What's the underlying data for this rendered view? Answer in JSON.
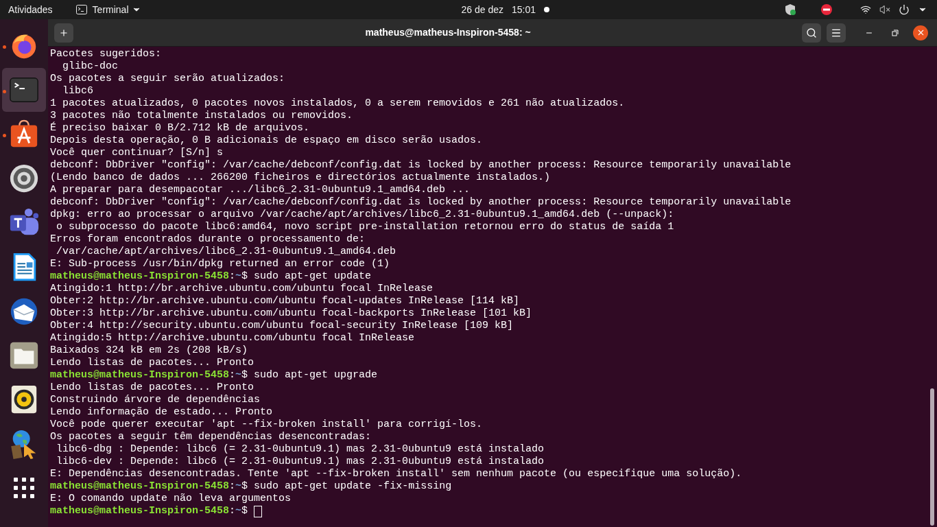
{
  "top_bar": {
    "activities": "Atividades",
    "app_menu": "Terminal",
    "date": "26 de dez",
    "time": "15:01",
    "notification_dot": true
  },
  "dock": {
    "items": [
      {
        "kind": "browser",
        "running": true,
        "selected": false
      },
      {
        "kind": "terminal",
        "running": true,
        "selected": true
      },
      {
        "kind": "store",
        "running": true,
        "selected": false
      },
      {
        "kind": "settings",
        "running": false,
        "selected": false
      },
      {
        "kind": "teams",
        "running": false,
        "selected": false
      },
      {
        "kind": "writer",
        "running": false,
        "selected": false
      },
      {
        "kind": "mail",
        "running": false,
        "selected": false
      },
      {
        "kind": "files",
        "running": false,
        "selected": false
      },
      {
        "kind": "speaker",
        "running": false,
        "selected": false
      },
      {
        "kind": "globe",
        "running": false,
        "selected": false
      },
      {
        "kind": "grid",
        "running": false,
        "selected": false
      }
    ]
  },
  "window": {
    "title": "matheus@matheus-Inspiron-5458: ~"
  },
  "terminal": {
    "lines": [
      {
        "kind": "output",
        "text": "Pacotes sugeridos:"
      },
      {
        "kind": "output",
        "text": "  glibc-doc"
      },
      {
        "kind": "output",
        "text": "Os pacotes a seguir serão atualizados:"
      },
      {
        "kind": "output",
        "text": "  libc6"
      },
      {
        "kind": "output",
        "text": "1 pacotes atualizados, 0 pacotes novos instalados, 0 a serem removidos e 261 não atualizados."
      },
      {
        "kind": "output",
        "text": "3 pacotes não totalmente instalados ou removidos."
      },
      {
        "kind": "output",
        "text": "É preciso baixar 0 B/2.712 kB de arquivos."
      },
      {
        "kind": "output",
        "text": "Depois desta operação, 0 B adicionais de espaço em disco serão usados."
      },
      {
        "kind": "output",
        "text": "Você quer continuar? [S/n] s"
      },
      {
        "kind": "output",
        "text": "debconf: DbDriver \"config\": /var/cache/debconf/config.dat is locked by another process: Resource temporarily unavailable"
      },
      {
        "kind": "output",
        "text": "(Lendo banco de dados ... 266200 ficheiros e directórios actualmente instalados.)"
      },
      {
        "kind": "output",
        "text": "A preparar para desempacotar .../libc6_2.31-0ubuntu9.1_amd64.deb ..."
      },
      {
        "kind": "output",
        "text": "debconf: DbDriver \"config\": /var/cache/debconf/config.dat is locked by another process: Resource temporarily unavailable"
      },
      {
        "kind": "output",
        "text": "dpkg: erro ao processar o arquivo /var/cache/apt/archives/libc6_2.31-0ubuntu9.1_amd64.deb (--unpack):"
      },
      {
        "kind": "output",
        "text": " o subprocesso do pacote libc6:amd64, novo script pre-installation retornou erro do status de saída 1"
      },
      {
        "kind": "output",
        "text": "Erros foram encontrados durante o processamento de:"
      },
      {
        "kind": "output",
        "text": " /var/cache/apt/archives/libc6_2.31-0ubuntu9.1_amd64.deb"
      },
      {
        "kind": "output",
        "text": "E: Sub-process /usr/bin/dpkg returned an error code (1)"
      },
      {
        "kind": "prompt",
        "user": "matheus@matheus-Inspiron-5458",
        "separator": ":",
        "path": "~",
        "symbol": "$",
        "command": "sudo apt-get update",
        "cursor": false
      },
      {
        "kind": "output",
        "text": "Atingido:1 http://br.archive.ubuntu.com/ubuntu focal InRelease"
      },
      {
        "kind": "output",
        "text": "Obter:2 http://br.archive.ubuntu.com/ubuntu focal-updates InRelease [114 kB]"
      },
      {
        "kind": "output",
        "text": "Obter:3 http://br.archive.ubuntu.com/ubuntu focal-backports InRelease [101 kB]"
      },
      {
        "kind": "output",
        "text": "Obter:4 http://security.ubuntu.com/ubuntu focal-security InRelease [109 kB]"
      },
      {
        "kind": "output",
        "text": "Atingido:5 http://archive.ubuntu.com/ubuntu focal InRelease"
      },
      {
        "kind": "output",
        "text": "Baixados 324 kB em 2s (208 kB/s)"
      },
      {
        "kind": "output",
        "text": "Lendo listas de pacotes... Pronto"
      },
      {
        "kind": "prompt",
        "user": "matheus@matheus-Inspiron-5458",
        "separator": ":",
        "path": "~",
        "symbol": "$",
        "command": "sudo apt-get upgrade",
        "cursor": false
      },
      {
        "kind": "output",
        "text": "Lendo listas de pacotes... Pronto"
      },
      {
        "kind": "output",
        "text": "Construindo árvore de dependências"
      },
      {
        "kind": "output",
        "text": "Lendo informação de estado... Pronto"
      },
      {
        "kind": "output",
        "text": "Você pode querer executar 'apt --fix-broken install' para corrigí-los."
      },
      {
        "kind": "output",
        "text": "Os pacotes a seguir têm dependências desencontradas:"
      },
      {
        "kind": "output",
        "text": " libc6-dbg : Depende: libc6 (= 2.31-0ubuntu9.1) mas 2.31-0ubuntu9 está instalado"
      },
      {
        "kind": "output",
        "text": " libc6-dev : Depende: libc6 (= 2.31-0ubuntu9.1) mas 2.31-0ubuntu9 está instalado"
      },
      {
        "kind": "output",
        "text": "E: Dependências desencontradas. Tente 'apt --fix-broken install' sem nenhum pacote (ou especifique uma solução)."
      },
      {
        "kind": "prompt",
        "user": "matheus@matheus-Inspiron-5458",
        "separator": ":",
        "path": "~",
        "symbol": "$",
        "command": "sudo apt-get update -fix-missing",
        "cursor": false
      },
      {
        "kind": "output",
        "text": "E: O comando update não leva argumentos"
      },
      {
        "kind": "prompt",
        "user": "matheus@matheus-Inspiron-5458",
        "separator": ":",
        "path": "~",
        "symbol": "$",
        "cursor": true
      }
    ]
  }
}
